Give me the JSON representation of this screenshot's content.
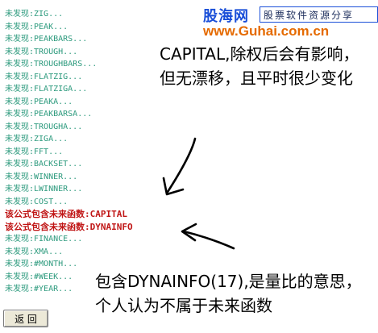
{
  "log": {
    "lines": [
      {
        "text": "未发现:ZIG...",
        "kind": "normal"
      },
      {
        "text": "未发现:PEAK...",
        "kind": "normal"
      },
      {
        "text": "未发现:PEAKBARS...",
        "kind": "normal"
      },
      {
        "text": "未发现:TROUGH...",
        "kind": "normal"
      },
      {
        "text": "未发现:TROUGHBARS...",
        "kind": "normal"
      },
      {
        "text": "未发现:FLATZIG...",
        "kind": "normal"
      },
      {
        "text": "未发现:FLATZIGA...",
        "kind": "normal"
      },
      {
        "text": "未发现:PEAKA...",
        "kind": "normal"
      },
      {
        "text": "未发现:PEAKBARSA...",
        "kind": "normal"
      },
      {
        "text": "未发现:TROUGHA...",
        "kind": "normal"
      },
      {
        "text": "未发现:ZIGA...",
        "kind": "normal"
      },
      {
        "text": "未发现:FFT...",
        "kind": "normal"
      },
      {
        "text": "未发现:BACKSET...",
        "kind": "normal"
      },
      {
        "text": "未发现:WINNER...",
        "kind": "normal"
      },
      {
        "text": "未发现:LWINNER...",
        "kind": "normal"
      },
      {
        "text": "未发现:COST...",
        "kind": "normal"
      },
      {
        "text": "该公式包含未来函数:CAPITAL",
        "kind": "warn"
      },
      {
        "text": "该公式包含未来函数:DYNAINFO",
        "kind": "warn"
      },
      {
        "text": "未发现:FINANCE...",
        "kind": "normal"
      },
      {
        "text": "未发现:XMA...",
        "kind": "normal"
      },
      {
        "text": "未发现:#MONTH...",
        "kind": "normal"
      },
      {
        "text": "未发现:#WEEK...",
        "kind": "normal"
      },
      {
        "text": "未发现:#YEAR...",
        "kind": "normal"
      }
    ]
  },
  "brand": {
    "name": "股海网",
    "slogan": "股票软件资源分享",
    "url": "www.Guhai.com.cn"
  },
  "annotations": {
    "capital_note": "CAPITAL,除权后会有影响，但无漂移，且平时很少变化",
    "dynainfo_note": "包含DYNAINFO(17),是量比的意思，个人认为不属于未来函数"
  },
  "buttons": {
    "back_label": "返 回"
  },
  "colors": {
    "log_text": "#2c9a7d",
    "warning_text": "#c01515",
    "brand_blue": "#1a4fd8",
    "brand_orange": "#e56a00"
  }
}
